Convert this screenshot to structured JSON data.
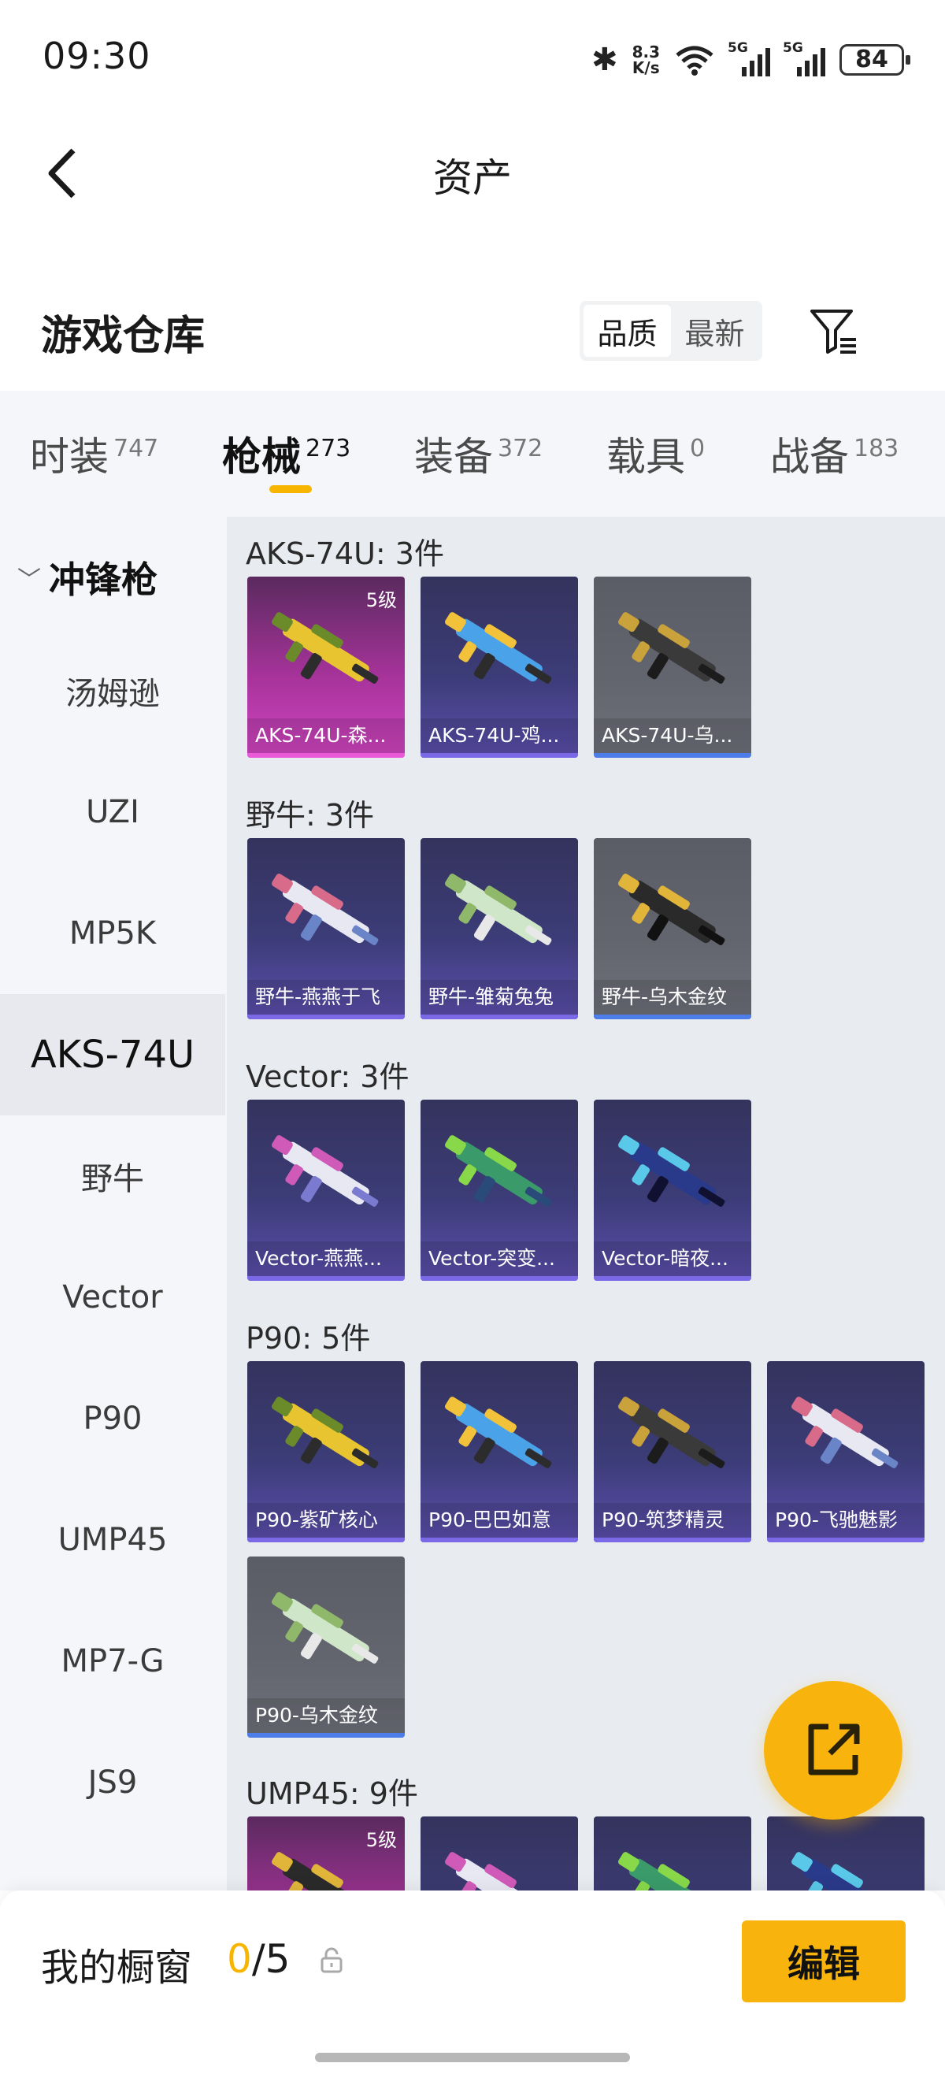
{
  "status_bar": {
    "time": "09:30",
    "net_speed_value": "8.3",
    "net_speed_unit": "K/s",
    "sim1": "5G",
    "sim2": "5G",
    "battery": "84"
  },
  "header": {
    "title": "资产",
    "back_icon": "chevron-left-icon"
  },
  "warehouse": {
    "title": "游戏仓库",
    "sort_options": [
      "品质",
      "最新"
    ],
    "sort_selected": "品质",
    "filter_icon": "filter-icon"
  },
  "tabs": [
    {
      "label": "时装",
      "count": "747"
    },
    {
      "label": "枪械",
      "count": "273",
      "active": true
    },
    {
      "label": "装备",
      "count": "372"
    },
    {
      "label": "载具",
      "count": "0"
    },
    {
      "label": "战备",
      "count": "183"
    }
  ],
  "sidebar": {
    "category": "冲锋枪",
    "items": [
      "汤姆逊",
      "UZI",
      "MP5K",
      "AKS-74U",
      "野牛",
      "Vector",
      "P90",
      "UMP45",
      "MP7-G",
      "JS9"
    ],
    "selected": "AKS-74U"
  },
  "groups": [
    {
      "title": "AKS-74U: 3件",
      "items": [
        {
          "name": "AKS-74U-森...",
          "level": "5级",
          "rarity": "pink"
        },
        {
          "name": "AKS-74U-鸡...",
          "rarity": "purple"
        },
        {
          "name": "AKS-74U-乌...",
          "rarity": "gray"
        }
      ]
    },
    {
      "title": "野牛: 3件",
      "items": [
        {
          "name": "野牛-燕燕于飞",
          "rarity": "purple"
        },
        {
          "name": "野牛-雏菊兔兔",
          "rarity": "purple"
        },
        {
          "name": "野牛-乌木金纹",
          "rarity": "gray"
        }
      ]
    },
    {
      "title": "Vector: 3件",
      "items": [
        {
          "name": "Vector-燕燕...",
          "rarity": "purple"
        },
        {
          "name": "Vector-突变...",
          "rarity": "purple"
        },
        {
          "name": "Vector-暗夜...",
          "rarity": "purple"
        }
      ]
    },
    {
      "title": "P90: 5件",
      "items": [
        {
          "name": "P90-紫矿核心",
          "rarity": "purple"
        },
        {
          "name": "P90-巴巴如意",
          "rarity": "purple"
        },
        {
          "name": "P90-筑梦精灵",
          "rarity": "purple"
        },
        {
          "name": "P90-飞驰魅影",
          "rarity": "purple"
        },
        {
          "name": "P90-乌木金纹",
          "rarity": "gray"
        }
      ]
    },
    {
      "title": "UMP45: 9件",
      "items": [
        {
          "name": "",
          "level": "5级",
          "rarity": "pink"
        },
        {
          "name": "",
          "rarity": "purple"
        },
        {
          "name": "",
          "rarity": "purple"
        },
        {
          "name": "",
          "rarity": "purple"
        }
      ]
    }
  ],
  "fab": {
    "icon": "share-external-icon"
  },
  "showcase": {
    "label": "我的橱窗",
    "current": "0",
    "total": "5",
    "lock_icon": "lock-icon",
    "edit_label": "编辑"
  },
  "colors": {
    "accent": "#f8b40c",
    "purple_card": "#3c3c78",
    "pink_card": "#a6339a",
    "gray_card": "#63656f"
  }
}
